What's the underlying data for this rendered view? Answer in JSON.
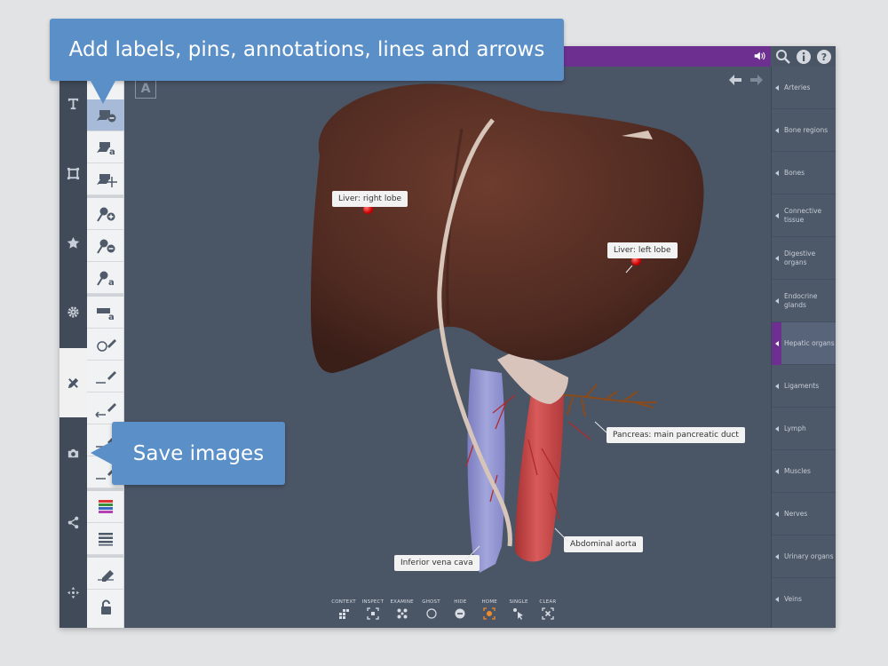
{
  "callouts": {
    "top": "Add labels, pins, annotations, lines and arrows",
    "save": "Save images"
  },
  "viewport": {
    "badge": "A",
    "labels": {
      "liver_right": "Liver: right lobe",
      "liver_left": "Liver: left lobe",
      "pancreas": "Pancreas: main pancreatic duct",
      "ivc": "Inferior vena cava",
      "aorta": "Abdominal aorta"
    }
  },
  "bottombar": {
    "context": "CONTEXT",
    "inspect": "INSPECT",
    "examine": "EXAMINE",
    "ghost": "GHOST",
    "hide": "HIDE",
    "home": "HOME",
    "single": "SINGLE",
    "clear": "CLEAR"
  },
  "rightbar": {
    "items": [
      {
        "label": "Arteries"
      },
      {
        "label": "Bone regions"
      },
      {
        "label": "Bones"
      },
      {
        "label": "Connective tissue"
      },
      {
        "label": "Digestive organs"
      },
      {
        "label": "Endocrine glands"
      },
      {
        "label": "Hepatic organs"
      },
      {
        "label": "Ligaments"
      },
      {
        "label": "Lymph"
      },
      {
        "label": "Muscles"
      },
      {
        "label": "Nerves"
      },
      {
        "label": "Urinary organs"
      },
      {
        "label": "Veins"
      }
    ],
    "active": "Hepatic organs"
  },
  "colors": {
    "header": "#6d3090",
    "callout": "#5b8fc8",
    "viewport": "#4a5566",
    "liver": "#4f2a21",
    "aorta": "#c84646",
    "ivc": "#8d8fd0"
  },
  "icons": {
    "header": [
      "speaker-icon",
      "search-icon",
      "info-icon",
      "help-icon"
    ],
    "leftnav": [
      "text-icon",
      "frame-icon",
      "star-icon",
      "gear-icon",
      "pencil-tools-icon",
      "camera-icon",
      "share-icon",
      "move-icon"
    ]
  }
}
